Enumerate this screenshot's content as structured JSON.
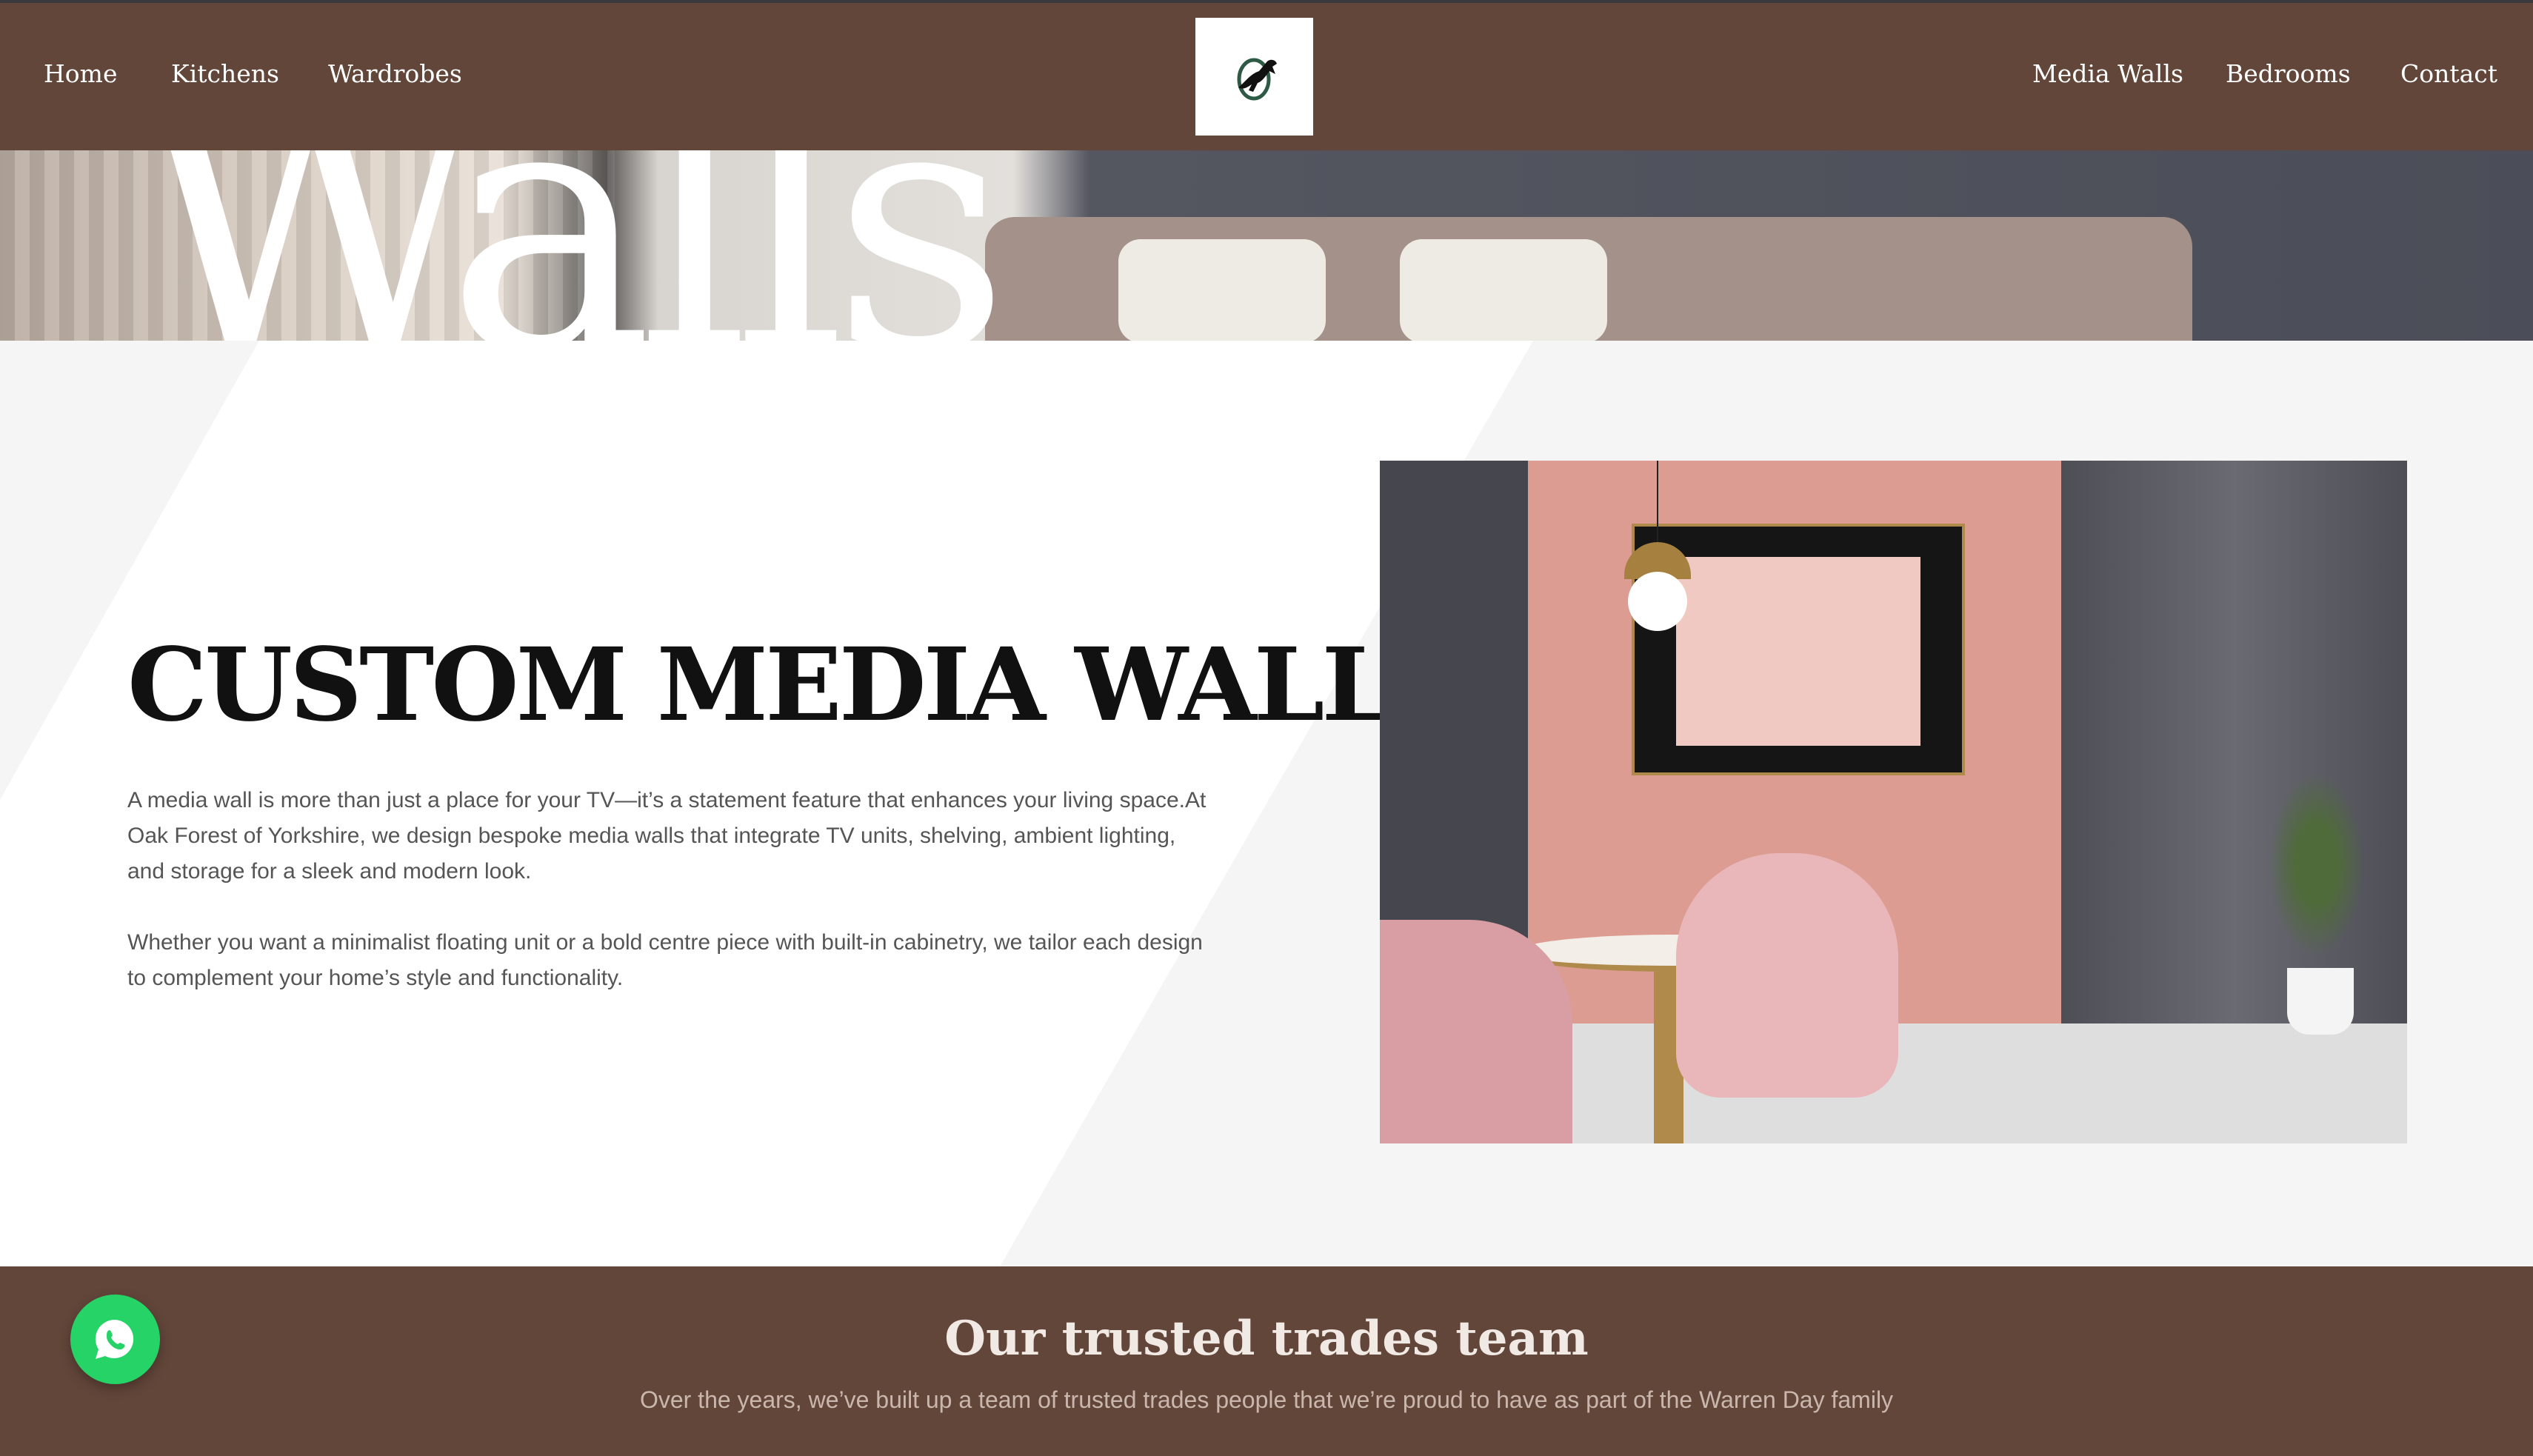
{
  "nav": {
    "left": [
      "Home",
      "Kitchens",
      "Wardrobes"
    ],
    "right": [
      "Media Walls",
      "Bedrooms",
      "Contact"
    ],
    "logo_icon": "horse-o-logo"
  },
  "hero": {
    "word": "Walls"
  },
  "main": {
    "heading": "CUSTOM MEDIA WALLS",
    "paragraphs": [
      "A media wall is more than just a place for your TV—it’s a statement feature that enhances your living space.At Oak Forest of Yorkshire, we design bespoke media walls that integrate TV units, shelving, ambient lighting, and storage for a sleek and modern look.",
      "Whether you want a minimalist floating unit or a bold centre piece with built-in cabinetry, we tailor each design to complement your home’s style and functionality."
    ]
  },
  "footer": {
    "title": "Our trusted trades team",
    "subtitle": "Over the years, we’ve built up a team of trusted trades people that we’re proud to have as part of the Warren Day family"
  },
  "colors": {
    "brand": "#63463a",
    "whatsapp": "#25d366"
  }
}
